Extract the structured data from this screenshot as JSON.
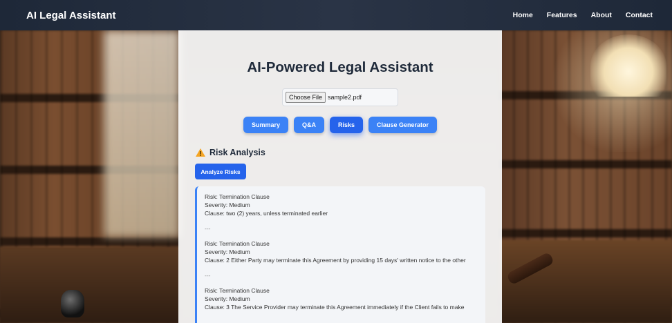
{
  "navbar": {
    "brand": "AI Legal Assistant",
    "links": [
      "Home",
      "Features",
      "About",
      "Contact"
    ]
  },
  "main": {
    "title": "AI-Powered Legal Assistant",
    "file_input": {
      "button_label": "Choose File",
      "file_name": "sample2.pdf"
    },
    "tabs": [
      {
        "label": "Summary",
        "active": false
      },
      {
        "label": "Q&A",
        "active": false
      },
      {
        "label": "Risks",
        "active": true
      },
      {
        "label": "Clause Generator",
        "active": false
      }
    ],
    "section": {
      "icon": "warning-icon",
      "title": "Risk Analysis"
    },
    "analyze_button": "Analyze Risks",
    "results": {
      "separator": "---",
      "risks": [
        {
          "risk": "Risk: Termination Clause",
          "severity": "Severity: Medium",
          "clause": "Clause: two (2) years, unless terminated earlier"
        },
        {
          "risk": "Risk: Termination Clause",
          "severity": "Severity: Medium",
          "clause": "Clause: 2 Either Party may terminate this Agreement by providing 15 days' written notice to the other"
        },
        {
          "risk": "Risk: Termination Clause",
          "severity": "Severity: Medium",
          "clause": "Clause: 3 The Service Provider may terminate this Agreement immediately if the Client fails to make"
        }
      ]
    }
  },
  "colors": {
    "accent": "#3b82f6",
    "accent_active": "#2563eb",
    "navbar": "#1e2838",
    "warning": "#f5a524"
  }
}
